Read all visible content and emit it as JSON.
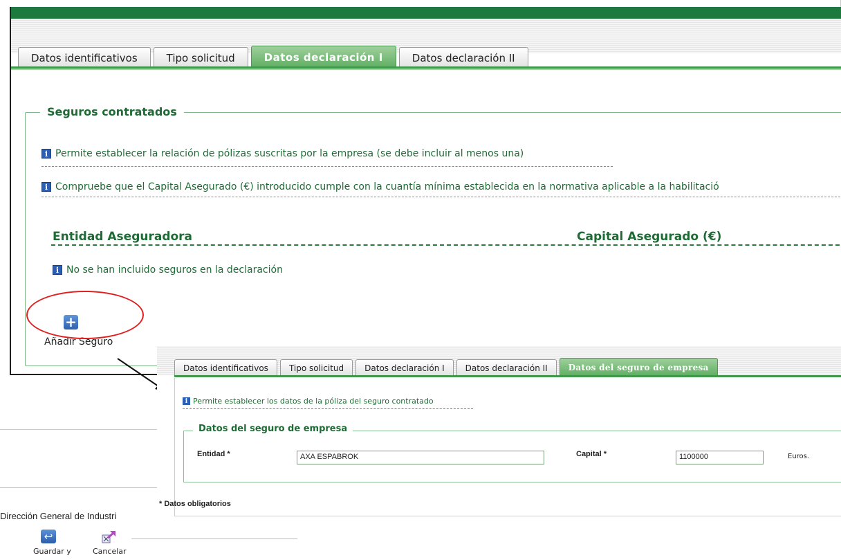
{
  "main": {
    "tabs": [
      {
        "label": "Datos identificativos"
      },
      {
        "label": "Tipo solicitud"
      },
      {
        "label": "Datos declaración I"
      },
      {
        "label": "Datos declaración II"
      }
    ],
    "active_tab": "Datos declaración I",
    "section_title": "Seguros contratados",
    "info_1": "Permite establecer la relación de pólizas suscritas por la empresa (se debe incluir al menos una)",
    "info_2": "Compruebe que el Capital Asegurado (€) introducido cumple con la cuantía mínima establecida en la normativa aplicable a la habilitació",
    "columns": [
      "Entidad Aseguradora",
      "Capital Asegurado (€)"
    ],
    "empty_message": "No se han incluido seguros en la declaración",
    "add_button": "Añadir Seguro"
  },
  "footer": {
    "text": "Dirección General de Industri"
  },
  "detail": {
    "tabs": [
      {
        "label": "Datos identificativos"
      },
      {
        "label": "Tipo solicitud"
      },
      {
        "label": "Datos declaración I"
      },
      {
        "label": "Datos declaración II"
      },
      {
        "label": "Datos del seguro de empresa"
      }
    ],
    "active_tab": "Datos del seguro de empresa",
    "info": "Permite establecer los datos de la póliza del seguro contratado",
    "section_title": "Datos del seguro de empresa",
    "entidad_label": "Entidad *",
    "entidad_value": "AXA ESPABROK",
    "capital_label": "Capital *",
    "capital_value": "1100000",
    "capital_unit": "Euros.",
    "required_note": "* Datos obligatorios",
    "save_button": "Guardar y",
    "cancel_button": "Cancelar"
  },
  "colors": {
    "accent_green": "#1c7a3e",
    "tab_active": "#5fae62",
    "annotation_red": "#e02020"
  },
  "icons": [
    "info-icon",
    "add-icon",
    "save-icon",
    "cancel-icon",
    "arrow-annotation"
  ]
}
